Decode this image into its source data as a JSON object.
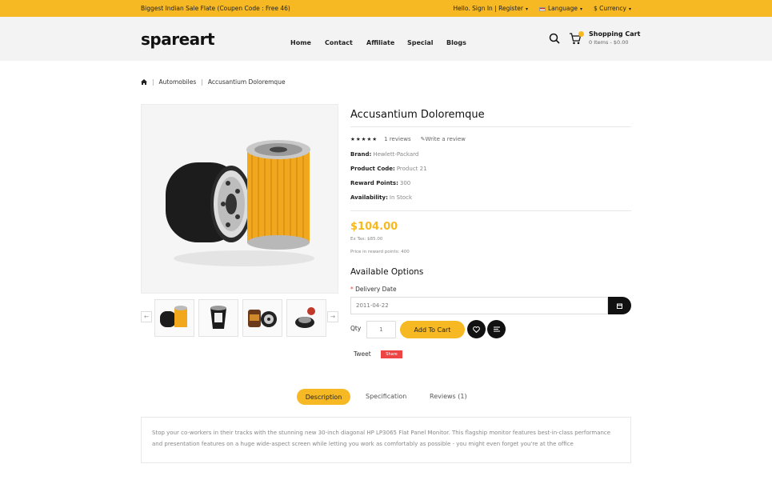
{
  "topbar": {
    "promo": "Biggest Indian Sale Flate (Coupen Code : Free 46)",
    "account": "Hello. Sign In | Register",
    "language": "Language",
    "currency": "$ Currency"
  },
  "header": {
    "logo": "spareart",
    "nav": [
      "Home",
      "Contact",
      "Affiliate",
      "Special",
      "Blogs"
    ],
    "cart_title": "Shopping Cart",
    "cart_sub": "0 Items - $0.00"
  },
  "breadcrumb": {
    "items": [
      "Automobiles",
      "Accusantium Doloremque"
    ]
  },
  "product": {
    "title": "Accusantium Doloremque",
    "stars": "★★★★★",
    "reviews": "1 reviews",
    "write_review": "Write a review",
    "brand_label": "Brand:",
    "brand_value": "Hewlett-Packard",
    "code_label": "Product Code:",
    "code_value": "Product 21",
    "reward_label": "Reward Points:",
    "reward_value": "300",
    "avail_label": "Availability:",
    "avail_value": "In Stock",
    "price": "$104.00",
    "ex_tax": "Ex Tax: $85.00",
    "reward_price": "Price in reward points: 400"
  },
  "options": {
    "title": "Available Options",
    "required": "*",
    "delivery_label": "Delivery Date",
    "delivery_value": "2011-04-22",
    "qty_label": "Qty",
    "qty_value": "1",
    "add_to_cart": "Add To Cart",
    "tweet": "Tweet",
    "share": "Share"
  },
  "tabs": {
    "description": "Description",
    "specification": "Specification",
    "reviews": "Reviews (1)"
  },
  "description": "Stop your co-workers in their tracks with the stunning new 30-inch diagonal HP LP3065 Flat Panel Monitor. This flagship monitor features best-in-class performance and presentation features on a huge wide-aspect screen while letting you work as comfortably as possible - you might even forget you're at the office",
  "colors": {
    "accent": "#f6b923",
    "dark": "#111111"
  }
}
